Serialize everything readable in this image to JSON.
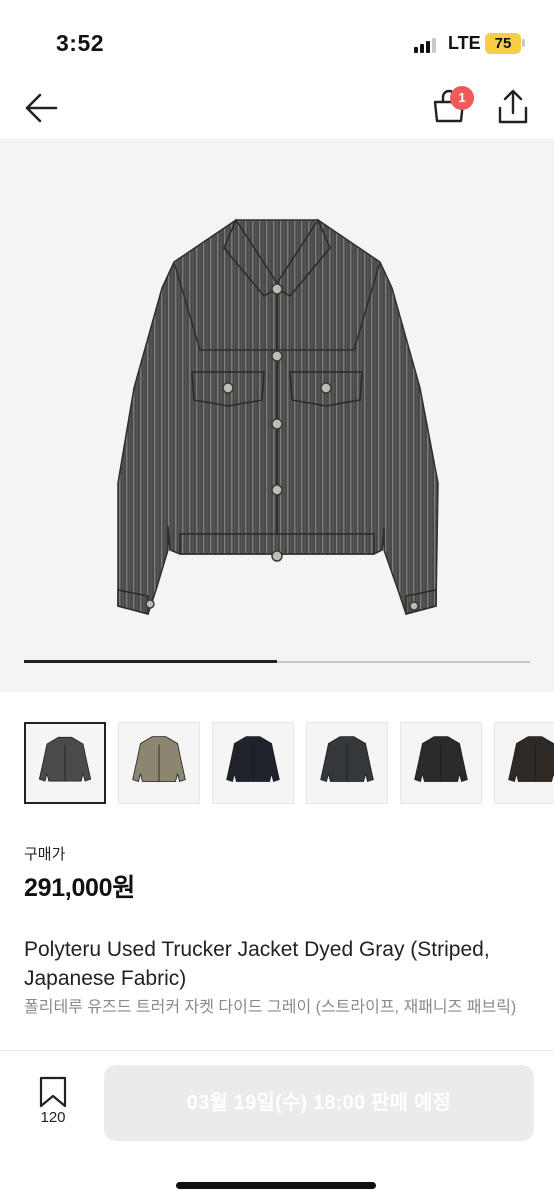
{
  "status_bar": {
    "time": "3:52",
    "network": "LTE",
    "battery": "75",
    "battery_color": "#f7cf46"
  },
  "nav": {
    "back_icon": "arrow-left-icon",
    "bag_icon": "shopping-bag-icon",
    "bag_badge": "1",
    "badge_color": "#ef5a5a",
    "share_icon": "share-icon"
  },
  "gallery": {
    "progress": 0.5,
    "thumbnails": [
      {
        "label": "jacket-gray-striped",
        "color": "#4a4a48",
        "active": true
      },
      {
        "label": "jacket-camo",
        "color": "#8a8670",
        "active": false
      },
      {
        "label": "jacket-navy",
        "color": "#1f222a",
        "active": false
      },
      {
        "label": "jacket-charcoal",
        "color": "#34383a",
        "active": false
      },
      {
        "label": "jacket-black",
        "color": "#2b2b2d",
        "active": false
      },
      {
        "label": "jacket-dark-brown",
        "color": "#2f2a26",
        "active": false
      }
    ]
  },
  "product": {
    "price_label": "구매가",
    "price": "291,000원",
    "title_en": "Polyteru Used Trucker Jacket Dyed Gray (Striped, Japanese Fabric)",
    "title_ko": "폴리테루 유즈드 트러커 자켓 다이드 그레이 (스트라이프, 재패니즈 패브릭)"
  },
  "bottom": {
    "wish_icon": "bookmark-icon",
    "wish_count": "120",
    "buy_label": "03월 19일(수) 18:00 판매 예정"
  }
}
